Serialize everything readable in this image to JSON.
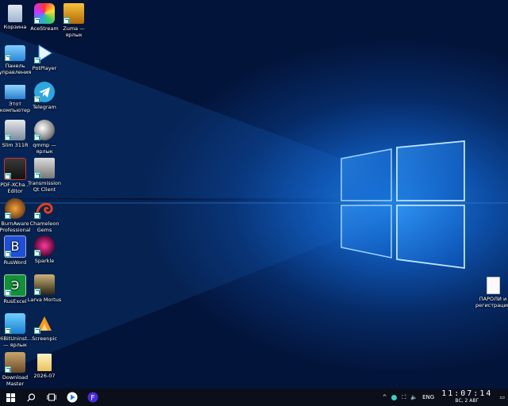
{
  "desktop": {
    "icons": [
      {
        "label": "Корзина"
      },
      {
        "label": "AceStream"
      },
      {
        "label": "Zuma — ярлык"
      },
      {
        "label": "Панель управления"
      },
      {
        "label": "PotPlayer"
      },
      {
        "label": "Этот компьютер"
      },
      {
        "label": "Telegram"
      },
      {
        "label": "Slim 311R"
      },
      {
        "label": "qmmp — ярлык"
      },
      {
        "label": "PDF-XCha... Editor"
      },
      {
        "label": "Transmission Qt Client"
      },
      {
        "label": "BurnAware Professional"
      },
      {
        "label": "Chameleon Gems"
      },
      {
        "label": "RusWord"
      },
      {
        "label": "Sparkle"
      },
      {
        "label": "RusExcel"
      },
      {
        "label": "Larva Mortus"
      },
      {
        "label": "HiBitUninst... — ярлык"
      },
      {
        "label": "Screenpic"
      },
      {
        "label": "Download Master"
      },
      {
        "label": "2026-07"
      },
      {
        "label": "ПАРОЛИ и регистрации"
      }
    ]
  },
  "taskbar": {
    "start_icon": "windows-logo-icon",
    "language": "ENG",
    "time": "11:07:14",
    "date": "ВС, 2 АВГ"
  }
}
